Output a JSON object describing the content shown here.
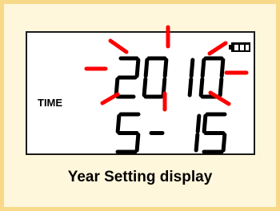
{
  "display": {
    "label": "TIME",
    "year": "2010",
    "date_month": "5",
    "date_separator": "-",
    "date_day": "15",
    "battery_icon": "battery-full-icon",
    "blink_indicator": "blink-rays-icon"
  },
  "caption": "Year Setting display",
  "colors": {
    "frame_border": "#f8d98a",
    "frame_fill": "#fff7dc",
    "lcd_border": "#1a1a1a",
    "segments": "#000000",
    "blink_rays": "#ff0000"
  }
}
